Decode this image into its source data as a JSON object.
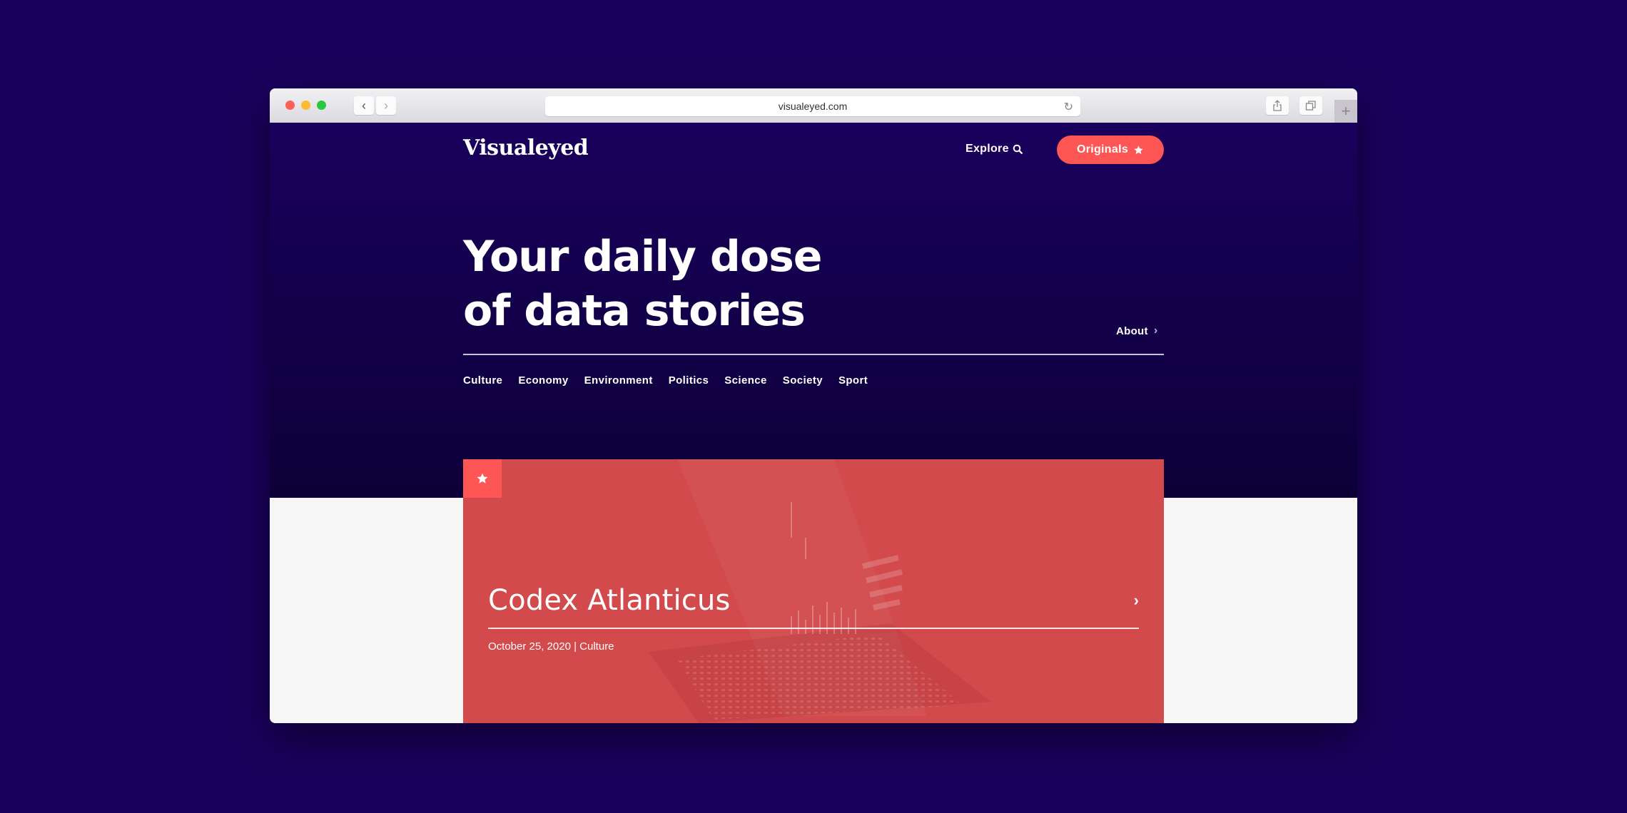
{
  "browser": {
    "url": "visualeyed.com",
    "back_icon": "‹",
    "forward_icon": "›",
    "reload_icon": "↻",
    "share_icon": "⇪",
    "tabs_icon": "❐",
    "new_tab_icon": "+"
  },
  "header": {
    "logo": "Visualeyed",
    "explore_label": "Explore",
    "originals_label": "Originals",
    "accent_color": "#fe5555"
  },
  "hero": {
    "headline_line1": "Your daily dose",
    "headline_line2": "of data stories",
    "about_label": "About",
    "categories": [
      "Culture",
      "Economy",
      "Environment",
      "Politics",
      "Science",
      "Society",
      "Sport"
    ]
  },
  "featured": {
    "title": "Codex Atlanticus",
    "date": "October 25, 2020",
    "category": "Culture",
    "separator": "|"
  }
}
